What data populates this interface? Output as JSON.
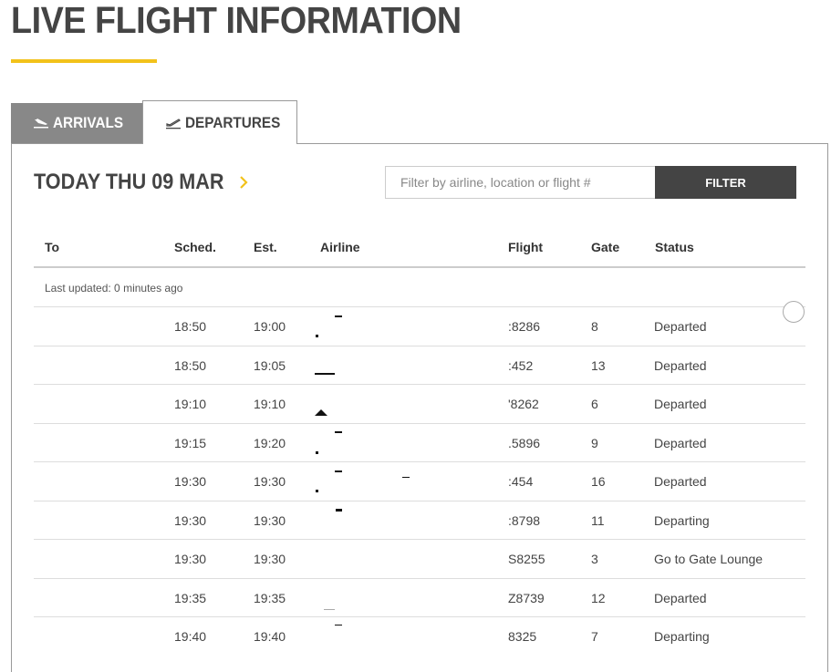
{
  "page": {
    "title": "LIVE FLIGHT INFORMATION"
  },
  "tabs": [
    {
      "label": "ARRIVALS",
      "icon": "plane-landing-icon",
      "active": false
    },
    {
      "label": "DEPARTURES",
      "icon": "plane-takeoff-icon",
      "active": true
    }
  ],
  "date_heading": "TODAY THU 09 MAR",
  "search": {
    "placeholder": "Filter by airline, location or flight #",
    "value": ""
  },
  "filter_label": "FILTER",
  "columns": {
    "to": "To",
    "sched": "Sched.",
    "est": "Est.",
    "airline": "Airline",
    "flight": "Flight",
    "gate": "Gate",
    "status": "Status"
  },
  "last_updated": "Last updated: 0 minutes ago",
  "flights": [
    {
      "to": "",
      "sched": "18:50",
      "est": "19:00",
      "flight": ":8286",
      "gate": "8",
      "status": "Departed"
    },
    {
      "to": "",
      "sched": "18:50",
      "est": "19:05",
      "flight": ":452",
      "gate": "13",
      "status": "Departed"
    },
    {
      "to": "",
      "sched": "19:10",
      "est": "19:10",
      "flight": "'8262",
      "gate": "6",
      "status": "Departed"
    },
    {
      "to": "",
      "sched": "19:15",
      "est": "19:20",
      "flight": ".5896",
      "gate": "9",
      "status": "Departed"
    },
    {
      "to": "",
      "sched": "19:30",
      "est": "19:30",
      "flight": ":454",
      "gate": "16",
      "status": "Departed"
    },
    {
      "to": "",
      "sched": "19:30",
      "est": "19:30",
      "flight": ":8798",
      "gate": "11",
      "status": "Departing"
    },
    {
      "to": "",
      "sched": "19:30",
      "est": "19:30",
      "flight": "S8255",
      "gate": "3",
      "status": "Go to Gate Lounge"
    },
    {
      "to": "",
      "sched": "19:35",
      "est": "19:35",
      "flight": "Z8739",
      "gate": "12",
      "status": "Departed"
    },
    {
      "to": "",
      "sched": "19:40",
      "est": "19:40",
      "flight": "8325",
      "gate": "7",
      "status": "Departing"
    }
  ],
  "colors": {
    "accent": "#f2c21b",
    "dark": "#444444",
    "tab_inactive": "#888888"
  }
}
